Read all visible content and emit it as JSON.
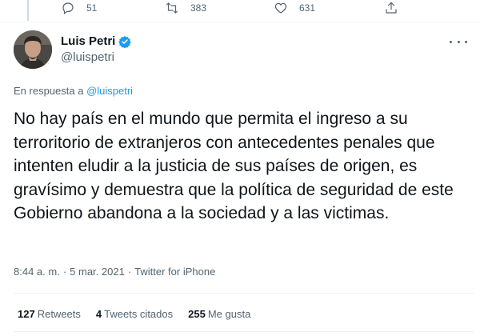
{
  "actions": {
    "reply_count": "51",
    "retweet_count": "383",
    "like_count": "631"
  },
  "author": {
    "name": "Luis Petri",
    "handle": "@luispetri"
  },
  "reply_context": {
    "prefix": "En respuesta a",
    "handle": "@luispetri"
  },
  "tweet": {
    "text": "No hay país en el mundo que permita el ingreso a su terroritorio de extranjeros con antecedentes penales que intenten eludir a la justicia de sus países de origen, es gravísimo y demuestra que la política de seguridad de este Gobierno abandona a la sociedad y a las victimas."
  },
  "meta": {
    "time": "8:44 a. m.",
    "separator": "·",
    "date": "5 mar. 2021",
    "source": "Twitter for iPhone"
  },
  "stats": {
    "retweets_count": "127",
    "retweets_label": "Retweets",
    "quotes_count": "4",
    "quotes_label": "Tweets citados",
    "likes_count": "255",
    "likes_label": "Me gusta"
  },
  "colors": {
    "link": "#1d9bf0",
    "secondary_text": "#536471",
    "primary_text": "#0f1419",
    "verified_badge": "#1d9bf0"
  }
}
